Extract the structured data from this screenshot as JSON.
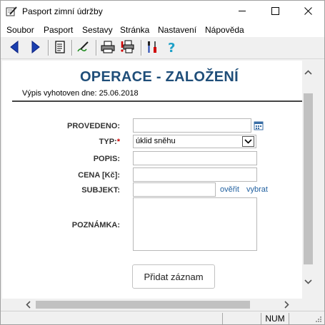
{
  "window": {
    "title": "Pasport zimní údržby",
    "icons": {
      "app": "pen-notepad-icon",
      "minimize": "minimize-icon",
      "maximize": "maximize-icon",
      "close": "close-icon"
    }
  },
  "menu": {
    "items": [
      "Soubor",
      "Pasport",
      "Sestavy",
      "Stránka",
      "Nastavení",
      "Nápověda"
    ]
  },
  "toolbar": {
    "buttons": [
      "back-arrow-icon",
      "forward-arrow-icon",
      "document-icon",
      "pen-icon",
      "printer-icon",
      "print-setup-icon",
      "tools-icon",
      "help-icon"
    ]
  },
  "page": {
    "title": "OPERACE - ZALOŽENÍ",
    "report_date": "Výpis vyhotoven dne: 25.06.2018"
  },
  "form": {
    "provedeno_label": "PROVEDENO:",
    "provedeno_value": "",
    "typ_label": "TYP:",
    "typ_required": "*",
    "typ_value": "úklid sněhu",
    "popis_label": "POPIS:",
    "popis_value": "",
    "cena_label": "CENA [Kč]:",
    "cena_value": "",
    "subjekt_label": "SUBJEKT:",
    "subjekt_value": "",
    "overit_link": "ověřit",
    "vybrat_link": "vybrat",
    "poznamka_label": "POZNÁMKA:",
    "poznamka_value": "",
    "submit_label": "Přidat záznam"
  },
  "statusbar": {
    "num": "NUM"
  },
  "colors": {
    "title": "#1f4e79",
    "link": "#1f5f9f",
    "required": "#cc0000"
  }
}
